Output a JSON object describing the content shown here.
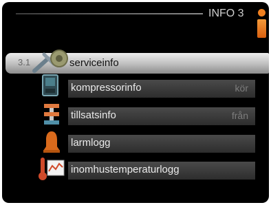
{
  "header": {
    "title": "INFO 3",
    "icon": "info-icon",
    "accent": "#f08020"
  },
  "menu": {
    "selected_index": 0,
    "items": [
      {
        "number": "3.1",
        "label": "serviceinfo",
        "value": "",
        "icon": "wrench-icon"
      },
      {
        "number": "",
        "label": "kompressorinfo",
        "value": "kör",
        "icon": "compressor-icon"
      },
      {
        "number": "",
        "label": "tillsatsinfo",
        "value": "från",
        "icon": "heater-icon"
      },
      {
        "number": "",
        "label": "larmlogg",
        "value": "",
        "icon": "bell-icon"
      },
      {
        "number": "",
        "label": "inomhustemperaturlogg",
        "value": "",
        "icon": "temperature-log-icon"
      }
    ]
  }
}
